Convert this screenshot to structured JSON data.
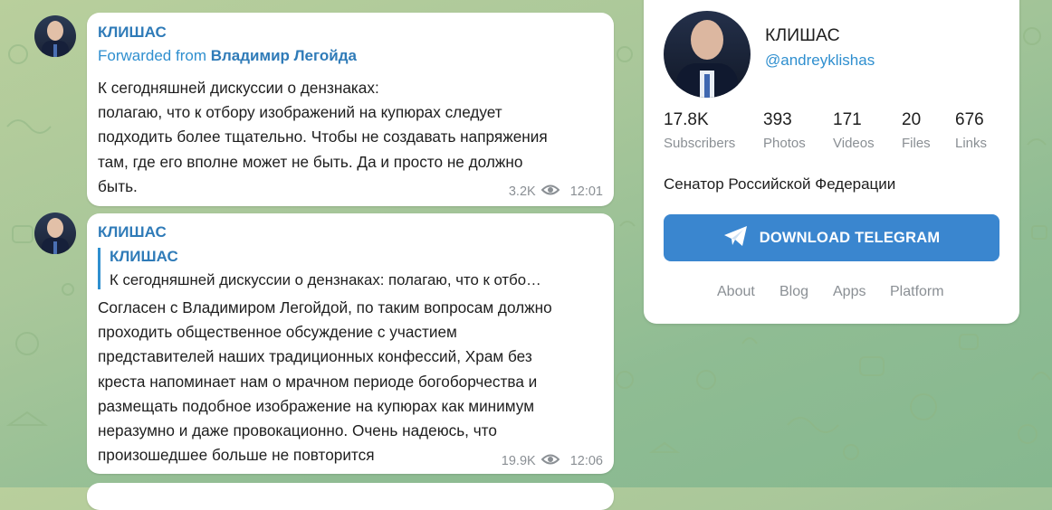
{
  "messages": [
    {
      "author": "КЛИШАС",
      "forwarded_prefix": "Forwarded from",
      "forwarded_from": "Владимир Легойда",
      "text": "К сегодняшней дискуссии о дензнаках:\nполагаю, что к отбору изображений на купюрах следует\nподходить более тщательно. Чтобы не создавать напряжения\nтам, где его вполне может не быть. Да и просто не должно\nбыть.",
      "views": "3.2K",
      "time": "12:01"
    },
    {
      "author": "КЛИШАС",
      "reply_author": "КЛИШАС",
      "reply_text": "К сегодняшней дискуссии о дензнаках: полагаю, что к отбо…",
      "text": "Согласен с Владимиром Легойдой, по таким вопросам должно\nпроходить общественное обсуждение с участием\nпредставителей наших традиционных конфессий, Храм без\nкреста напоминает нам о мрачном периоде богоборчества и\nразмещать подобное изображение на купюрах как минимум\nнеразумно и даже провокационно. Очень надеюсь, что\nпроизошедшее больше не повторится",
      "views": "19.9K",
      "time": "12:06"
    }
  ],
  "channel": {
    "name": "КЛИШАС",
    "username": "@andreyklishas",
    "stats": [
      {
        "value": "17.8K",
        "label": "Subscribers"
      },
      {
        "value": "393",
        "label": "Photos"
      },
      {
        "value": "171",
        "label": "Videos"
      },
      {
        "value": "20",
        "label": "Files"
      },
      {
        "value": "676",
        "label": "Links"
      }
    ],
    "description": "Сенатор Российской Федерации",
    "download_label": "DOWNLOAD TELEGRAM",
    "footer_links": [
      "About",
      "Blog",
      "Apps",
      "Platform"
    ]
  },
  "colors": {
    "accent": "#3a86cf",
    "link": "#2f7bb8",
    "background": "#a9c79a"
  }
}
